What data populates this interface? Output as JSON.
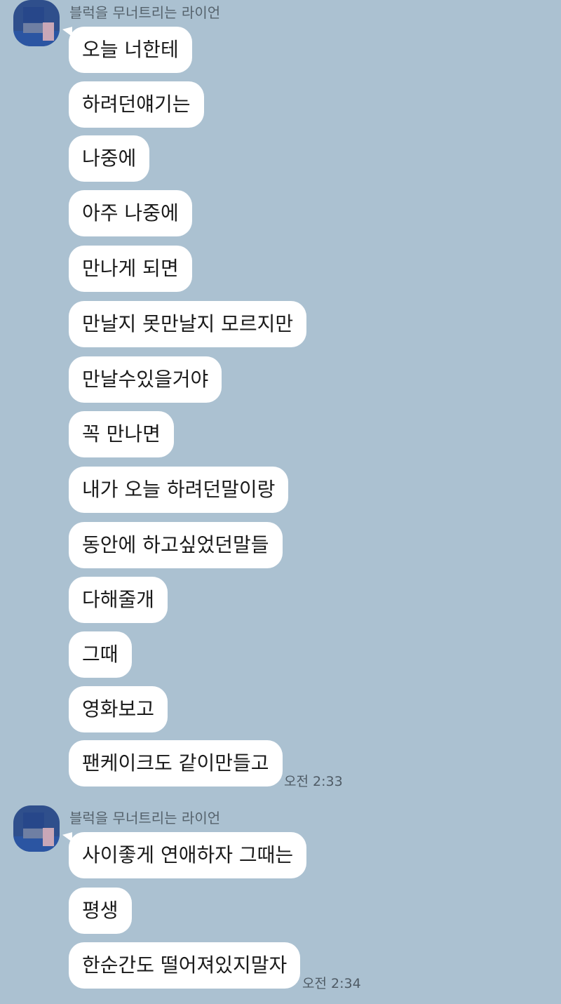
{
  "groups": [
    {
      "sender": "블럭을 무너트리는 라이언",
      "messages": [
        "오늘 너한테",
        "하려던얘기는",
        "나중에",
        "아주 나중에",
        "만나게 되면",
        "만날지 못만날지 모르지만",
        "만날수있을거야",
        "꼭 만나면",
        "내가 오늘 하려던말이랑",
        "동안에 하고싶었던말들",
        "다해줄개",
        "그때",
        "영화보고",
        "팬케이크도 같이만들고"
      ],
      "time": "오전 2:33"
    },
    {
      "sender": "블럭을 무너트리는 라이언",
      "messages": [
        "사이좋게 연애하자 그때는",
        "평생",
        "한순간도 떨어져있지말자"
      ],
      "time": "오전 2:34"
    }
  ]
}
